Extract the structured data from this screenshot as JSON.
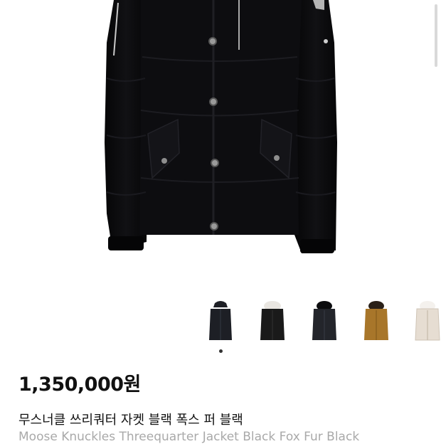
{
  "product": {
    "price": "1,350,000원",
    "title_ko": "무스너클 쓰리쿼터 자켓 블랙 폭스 퍼 블랙",
    "title_en": "Moose Knuckles Threequarter Jacket Black Fox Fur Black"
  },
  "gallery": {
    "thumbnails": [
      {
        "label": "black-jacket-hood",
        "color": "#1d1f25"
      },
      {
        "label": "black-jacket-white-fur",
        "color": "#1a1a1a"
      },
      {
        "label": "black-jacket-black-fur",
        "color": "#23252b"
      },
      {
        "label": "tan-jacket-fur",
        "color": "#a8762a"
      },
      {
        "label": "cream-jacket-fur",
        "color": "#e6ddd2"
      }
    ],
    "active_index": 0
  },
  "colors": {
    "accent_text": "#111111",
    "muted_text": "#a9a9a9",
    "jacket": "#0b0b0d"
  }
}
